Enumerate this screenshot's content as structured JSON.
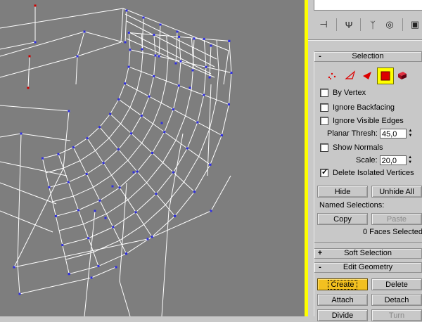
{
  "viewport": {
    "background": "#7e7e7e",
    "wire_color": "#ffffff",
    "vertex_color": "#3030e0",
    "selected_vertex_color": "#cc0000"
  },
  "command_panel": {
    "tabs": [
      {
        "name": "create-tab",
        "icon": "pin-icon",
        "glyph": "⊣"
      },
      {
        "name": "modify-tab",
        "icon": "fork-icon",
        "glyph": "Ψ"
      },
      {
        "name": "hierarchy-tab",
        "icon": "hierarchy-icon",
        "glyph": "ᛉ"
      },
      {
        "name": "motion-tab",
        "icon": "motion-icon",
        "glyph": "◎"
      },
      {
        "name": "display-tab",
        "icon": "display-icon",
        "glyph": "▣"
      }
    ],
    "selection": {
      "title": "Selection",
      "sign": "-",
      "subobject_icons": [
        "vertex-icon",
        "edge-icon",
        "face-icon",
        "polygon-icon",
        "element-icon"
      ],
      "by_vertex": {
        "label": "By Vertex",
        "checked": false
      },
      "ignore_backfacing": {
        "label": "Ignore Backfacing",
        "checked": false
      },
      "ignore_visible_edges": {
        "label": "Ignore Visible Edges",
        "checked": false
      },
      "planar_thresh": {
        "label": "Planar Thresh:",
        "value": "45,0"
      },
      "show_normals": {
        "label": "Show Normals",
        "checked": false
      },
      "scale": {
        "label": "Scale:",
        "value": "20,0"
      },
      "delete_isolated": {
        "label": "Delete Isolated Vertices",
        "checked": true,
        "tick": "✓"
      },
      "hide_label": "Hide",
      "unhide_all_label": "Unhide All",
      "named_selections_label": "Named Selections:",
      "copy_label": "Copy",
      "paste_label": "Paste",
      "status": "0 Faces Selected"
    },
    "soft_selection": {
      "title": "Soft Selection",
      "sign": "+"
    },
    "edit_geometry": {
      "title": "Edit Geometry",
      "sign": "-",
      "create_label": "Create",
      "delete_label": "Delete",
      "attach_label": "Attach",
      "detach_label": "Detach",
      "divide_label": "Divide",
      "turn_label": "Turn"
    },
    "accent_active": "#f2c020",
    "viewport_border": "#ffff00"
  }
}
